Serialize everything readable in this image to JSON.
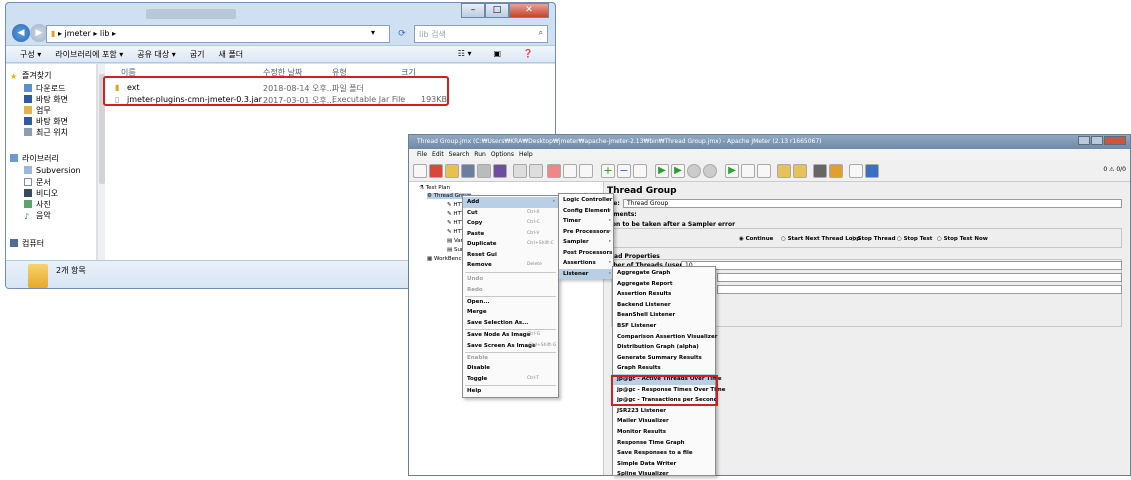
{
  "explorer": {
    "address": [
      "jmeter",
      "lib"
    ],
    "search_placeholder": "lib 검색",
    "toolbar": [
      "구성 ▾",
      "라이브러리에 포함 ▾",
      "공유 대상 ▾",
      "굽기",
      "새 폴더"
    ],
    "nav": {
      "favorites": "즐겨찾기",
      "fav_items": [
        "다운로드",
        "바탕 화면",
        "업무",
        "바탕 화면",
        "최근 위치"
      ],
      "libraries": "라이브러리",
      "lib_items": [
        "Subversion",
        "문서",
        "비디오",
        "사진",
        "음악"
      ],
      "computer": "컴퓨터"
    },
    "columns": [
      "이름",
      "수정한 날짜",
      "유형",
      "크기"
    ],
    "files": [
      {
        "name": "ext",
        "date": "2018-08-14 오후...",
        "type": "파일 폴더",
        "size": ""
      },
      {
        "name": "jmeter-plugins-cmn-jmeter-0.3.jar",
        "date": "2017-03-01 오후...",
        "type": "Executable Jar File",
        "size": "193KB"
      }
    ],
    "status": "2개 항목"
  },
  "jmeter": {
    "title": "Thread Group.jmx (C:₩Users₩KRA₩Desktop₩jmeter₩apache-jmeter-2.13₩bin₩Thread Group.jmx) - Apache JMeter (2.13 r1665067)",
    "menus": [
      "File",
      "Edit",
      "Search",
      "Run",
      "Options",
      "Help"
    ],
    "counter": "0 ⚠  0/0",
    "tree": {
      "test_plan": "Test Plan",
      "thread_group": "Thread Group",
      "children": [
        "HTT",
        "HTT",
        "HTT",
        "HTT",
        "Vari",
        "Sum"
      ],
      "workbench": "WorkBench"
    },
    "panel": {
      "heading": "Thread Group",
      "name_label": "me:",
      "name_value": "Thread Group",
      "comments_label": "mments:",
      "error_label": "tion to be taken after a Sampler error",
      "radios": [
        "Continue",
        "Start Next Thread Loop",
        "Stop Thread",
        "Stop Test",
        "Stop Test Now"
      ],
      "props_label": "read Properties",
      "threads_label": "mber of Threads (users):",
      "threads_value": "10"
    },
    "context_menu": [
      {
        "label": "Add",
        "shortcut": ""
      },
      {
        "label": "Cut",
        "shortcut": "Ctrl-X"
      },
      {
        "label": "Copy",
        "shortcut": "Ctrl-C"
      },
      {
        "label": "Paste",
        "shortcut": "Ctrl-V"
      },
      {
        "label": "Duplicate",
        "shortcut": "Ctrl+Shift-C"
      },
      {
        "label": "Reset Gui",
        "shortcut": ""
      },
      {
        "label": "Remove",
        "shortcut": "Delete"
      },
      {
        "label": "Undo",
        "shortcut": ""
      },
      {
        "label": "Redo",
        "shortcut": ""
      },
      {
        "label": "Open...",
        "shortcut": ""
      },
      {
        "label": "Merge",
        "shortcut": ""
      },
      {
        "label": "Save Selection As...",
        "shortcut": ""
      },
      {
        "label": "Save Node As Image",
        "shortcut": "Ctrl-G"
      },
      {
        "label": "Save Screen As Image",
        "shortcut": "Ctrl+Shift-G"
      },
      {
        "label": "Enable",
        "shortcut": ""
      },
      {
        "label": "Disable",
        "shortcut": ""
      },
      {
        "label": "Toggle",
        "shortcut": "Ctrl-T"
      },
      {
        "label": "Help",
        "shortcut": ""
      }
    ],
    "add_menu": [
      "Logic Controller",
      "Config Element",
      "Timer",
      "Pre Processors",
      "Sampler",
      "Post Processors",
      "Assertions",
      "Listener"
    ],
    "listener_menu": [
      "Aggregate Graph",
      "Aggregate Report",
      "Assertion Results",
      "Backend Listener",
      "BeanShell Listener",
      "BSF Listener",
      "Comparison Assertion Visualizer",
      "Distribution Graph (alpha)",
      "Generate Summary Results",
      "Graph Results",
      "jp@gc - Active Threads Over Time",
      "jp@gc - Response Times Over Time",
      "jp@gc - Transactions per Second",
      "JSR223 Listener",
      "Mailer Visualizer",
      "Monitor Results",
      "Response Time Graph",
      "Save Responses to a file",
      "Simple Data Writer",
      "Spline Visualizer"
    ]
  }
}
